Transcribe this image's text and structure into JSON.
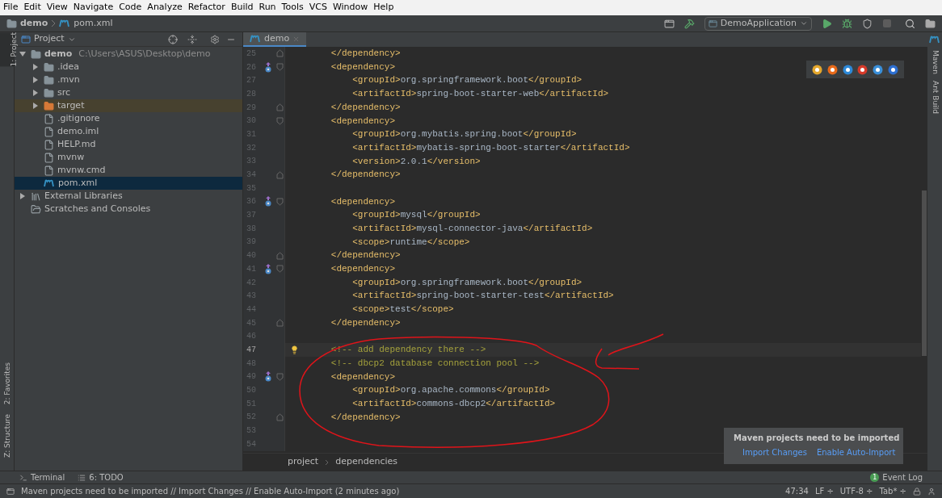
{
  "menu": [
    "File",
    "Edit",
    "View",
    "Navigate",
    "Code",
    "Analyze",
    "Refactor",
    "Build",
    "Run",
    "Tools",
    "VCS",
    "Window",
    "Help"
  ],
  "breadcrumb": {
    "project": "demo",
    "file": "pom.xml"
  },
  "run_config": "DemoApplication",
  "left_strip": [
    {
      "label": "1: Project",
      "selected": true
    },
    {
      "label": "2: Favorites",
      "selected": false
    },
    {
      "label": "Z: Structure",
      "selected": false
    }
  ],
  "right_strip": [
    "Maven",
    "Ant Build"
  ],
  "project_panel": {
    "title": "Project",
    "tree": [
      {
        "label": "demo",
        "path": "C:\\Users\\ASUS\\Desktop\\demo",
        "kind": "module",
        "expanded": true,
        "selected": false,
        "children": [
          {
            "label": ".idea",
            "kind": "folder",
            "expanded": false,
            "selected": false
          },
          {
            "label": ".mvn",
            "kind": "folder",
            "expanded": false,
            "selected": false
          },
          {
            "label": "src",
            "kind": "folder",
            "expanded": false,
            "selected": false
          },
          {
            "label": "target",
            "kind": "excluded",
            "expanded": false,
            "selected": false
          },
          {
            "label": ".gitignore",
            "kind": "file",
            "selected": false
          },
          {
            "label": "demo.iml",
            "kind": "file",
            "selected": false
          },
          {
            "label": "HELP.md",
            "kind": "file",
            "selected": false
          },
          {
            "label": "mvnw",
            "kind": "file",
            "selected": false
          },
          {
            "label": "mvnw.cmd",
            "kind": "file",
            "selected": false
          },
          {
            "label": "pom.xml",
            "kind": "pom",
            "selected": true
          }
        ]
      },
      {
        "label": "External Libraries",
        "kind": "libraries",
        "expanded": false,
        "selected": false
      },
      {
        "label": "Scratches and Consoles",
        "kind": "scratches",
        "selected": false
      }
    ]
  },
  "editor_tab": {
    "label": "demo",
    "selected": true
  },
  "code_lines": [
    {
      "number": "25",
      "text": "        </dependency>",
      "kind": "tag",
      "fold_start": false,
      "fold_end": true,
      "maven": false,
      "current": false
    },
    {
      "number": "26",
      "text": "        <dependency>",
      "kind": "tag",
      "fold_start": true,
      "fold_end": false,
      "maven": true,
      "current": false
    },
    {
      "number": "27",
      "text": "            <groupId>org.springframework.boot</groupId>",
      "kind": "tag",
      "fold_start": false,
      "fold_end": false,
      "maven": false,
      "current": false
    },
    {
      "number": "28",
      "text": "            <artifactId>spring-boot-starter-web</artifactId>",
      "kind": "tag",
      "fold_start": false,
      "fold_end": false,
      "maven": false,
      "current": false
    },
    {
      "number": "29",
      "text": "        </dependency>",
      "kind": "tag",
      "fold_start": false,
      "fold_end": true,
      "maven": false,
      "current": false
    },
    {
      "number": "30",
      "text": "        <dependency>",
      "kind": "tag",
      "fold_start": true,
      "fold_end": false,
      "maven": false,
      "current": false
    },
    {
      "number": "31",
      "text": "            <groupId>org.mybatis.spring.boot</groupId>",
      "kind": "tag",
      "fold_start": false,
      "fold_end": false,
      "maven": false,
      "current": false
    },
    {
      "number": "32",
      "text": "            <artifactId>mybatis-spring-boot-starter</artifactId>",
      "kind": "tag",
      "fold_start": false,
      "fold_end": false,
      "maven": false,
      "current": false
    },
    {
      "number": "33",
      "text": "            <version>2.0.1</version>",
      "kind": "tag",
      "fold_start": false,
      "fold_end": false,
      "maven": false,
      "current": false
    },
    {
      "number": "34",
      "text": "        </dependency>",
      "kind": "tag",
      "fold_start": false,
      "fold_end": true,
      "maven": false,
      "current": false
    },
    {
      "number": "35",
      "kind": "blank",
      "fold_start": false,
      "fold_end": false,
      "maven": false,
      "current": false
    },
    {
      "number": "36",
      "text": "        <dependency>",
      "kind": "tag",
      "fold_start": true,
      "fold_end": false,
      "maven": true,
      "current": false
    },
    {
      "number": "37",
      "text": "            <groupId>mysql</groupId>",
      "kind": "tag",
      "fold_start": false,
      "fold_end": false,
      "maven": false,
      "current": false
    },
    {
      "number": "38",
      "text": "            <artifactId>mysql-connector-java</artifactId>",
      "kind": "tag",
      "fold_start": false,
      "fold_end": false,
      "maven": false,
      "current": false
    },
    {
      "number": "39",
      "text": "            <scope>runtime</scope>",
      "kind": "tag",
      "fold_start": false,
      "fold_end": false,
      "maven": false,
      "current": false
    },
    {
      "number": "40",
      "text": "        </dependency>",
      "kind": "tag",
      "fold_start": false,
      "fold_end": true,
      "maven": false,
      "current": false
    },
    {
      "number": "41",
      "text": "        <dependency>",
      "kind": "tag",
      "fold_start": true,
      "fold_end": false,
      "maven": true,
      "current": false
    },
    {
      "number": "42",
      "text": "            <groupId>org.springframework.boot</groupId>",
      "kind": "tag",
      "fold_start": false,
      "fold_end": false,
      "maven": false,
      "current": false
    },
    {
      "number": "43",
      "text": "            <artifactId>spring-boot-starter-test</artifactId>",
      "kind": "tag",
      "fold_start": false,
      "fold_end": false,
      "maven": false,
      "current": false
    },
    {
      "number": "44",
      "text": "            <scope>test</scope>",
      "kind": "tag",
      "fold_start": false,
      "fold_end": false,
      "maven": false,
      "current": false
    },
    {
      "number": "45",
      "text": "        </dependency>",
      "kind": "tag",
      "fold_start": false,
      "fold_end": true,
      "maven": false,
      "current": false
    },
    {
      "number": "46",
      "kind": "blank",
      "fold_start": false,
      "fold_end": false,
      "maven": false,
      "current": false
    },
    {
      "number": "47",
      "text": "        <!-- add dependency there -->",
      "kind": "comment",
      "fold_start": false,
      "fold_end": false,
      "maven": false,
      "current": true
    },
    {
      "number": "48",
      "text": "        <!-- dbcp2 database connection pool -->",
      "kind": "comment",
      "fold_start": false,
      "fold_end": false,
      "maven": false,
      "current": false
    },
    {
      "number": "49",
      "text": "        <dependency>",
      "kind": "tag",
      "fold_start": true,
      "fold_end": false,
      "maven": true,
      "current": false
    },
    {
      "number": "50",
      "text": "            <groupId>org.apache.commons</groupId>",
      "kind": "tag",
      "fold_start": false,
      "fold_end": false,
      "maven": false,
      "current": false
    },
    {
      "number": "51",
      "text": "            <artifactId>commons-dbcp2</artifactId>",
      "kind": "tag",
      "fold_start": false,
      "fold_end": false,
      "maven": false,
      "current": false
    },
    {
      "number": "52",
      "text": "        </dependency>",
      "kind": "tag",
      "fold_start": false,
      "fold_end": true,
      "maven": false,
      "current": false
    },
    {
      "number": "53",
      "kind": "blank",
      "fold_start": false,
      "fold_end": false,
      "maven": false,
      "current": false
    },
    {
      "number": "54",
      "kind": "blank",
      "fold_start": false,
      "fold_end": false,
      "maven": false,
      "current": false
    }
  ],
  "editor_breadcrumb": [
    "project",
    "dependencies"
  ],
  "notification": {
    "title": "Maven projects need to be imported",
    "links": [
      "Import Changes",
      "Enable Auto-Import"
    ]
  },
  "bottom_tools": {
    "left": [
      "Terminal",
      "6: TODO"
    ],
    "event_log": {
      "count": "1",
      "label": "Event Log"
    }
  },
  "status_bar": {
    "message": "Maven projects need to be imported // Import Changes // Enable Auto-Import (2 minutes ago)",
    "position": "47:34",
    "items": [
      "LF ÷",
      "UTF-8 ÷",
      "Tab* ÷"
    ]
  }
}
